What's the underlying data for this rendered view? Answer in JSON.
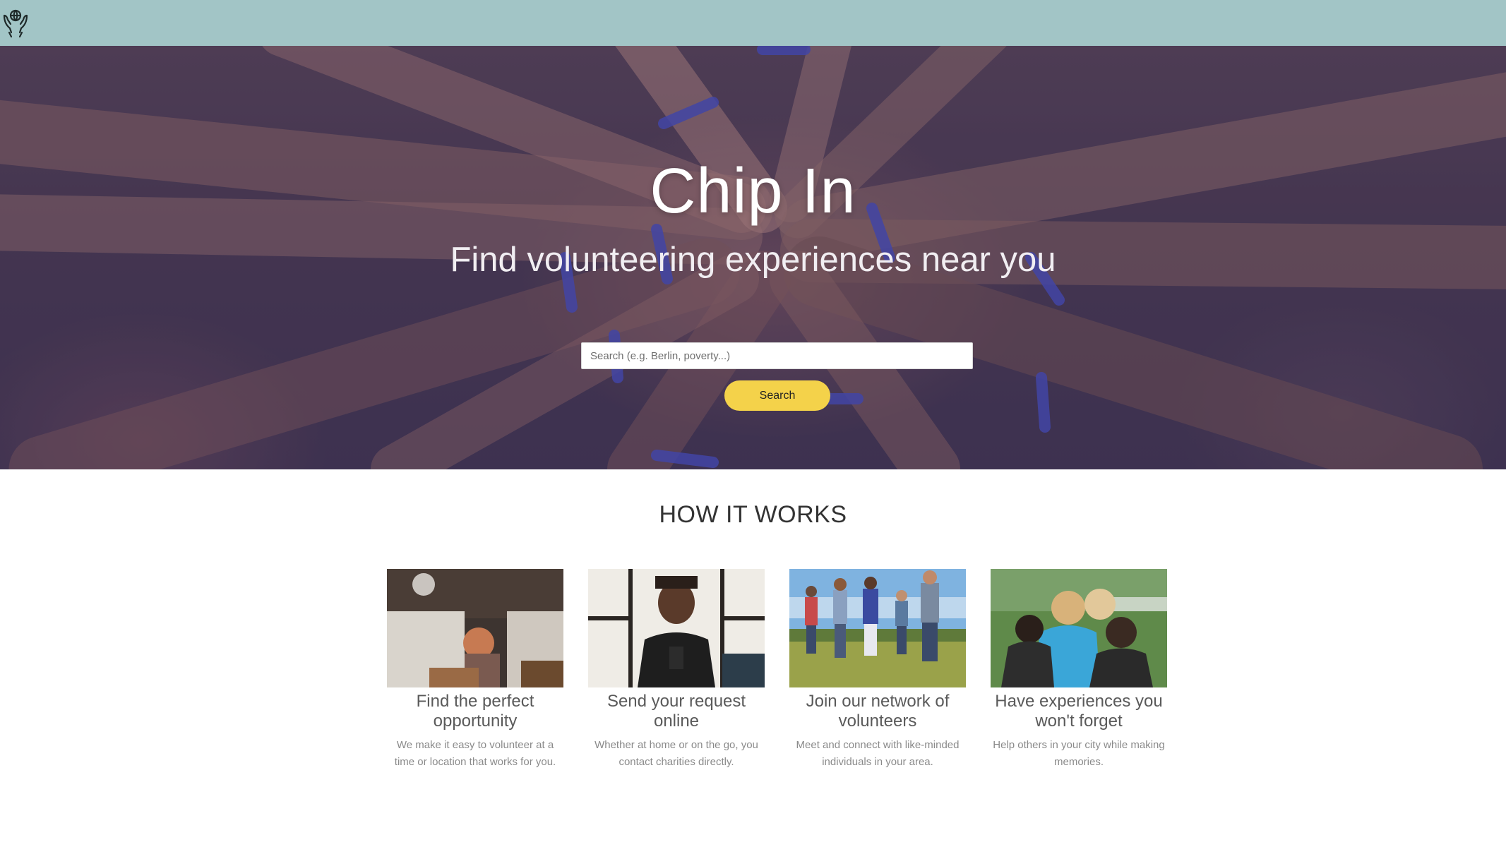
{
  "nav": {
    "logo_icon": "hands-globe-icon",
    "background_color": "#a2c5c6"
  },
  "hero": {
    "title": "Chip In",
    "subtitle": "Find volunteering experiences near you",
    "search": {
      "placeholder": "Search (e.g. Berlin, poverty...)",
      "value": ""
    },
    "search_button_label": "Search",
    "search_button_color": "#f4d24a"
  },
  "how_it_works": {
    "title": "HOW IT WORKS",
    "steps": [
      {
        "title": "Find the perfect opportunity",
        "description": "We make it easy to volunteer at a time or location that works for you."
      },
      {
        "title": "Send your request online",
        "description": "Whether at home or on the go, you contact charities directly."
      },
      {
        "title": "Join our network of volunteers",
        "description": "Meet and connect with like-minded individuals in your area."
      },
      {
        "title": "Have experiences you won't forget",
        "description": "Help others in your city while making memories."
      }
    ]
  }
}
